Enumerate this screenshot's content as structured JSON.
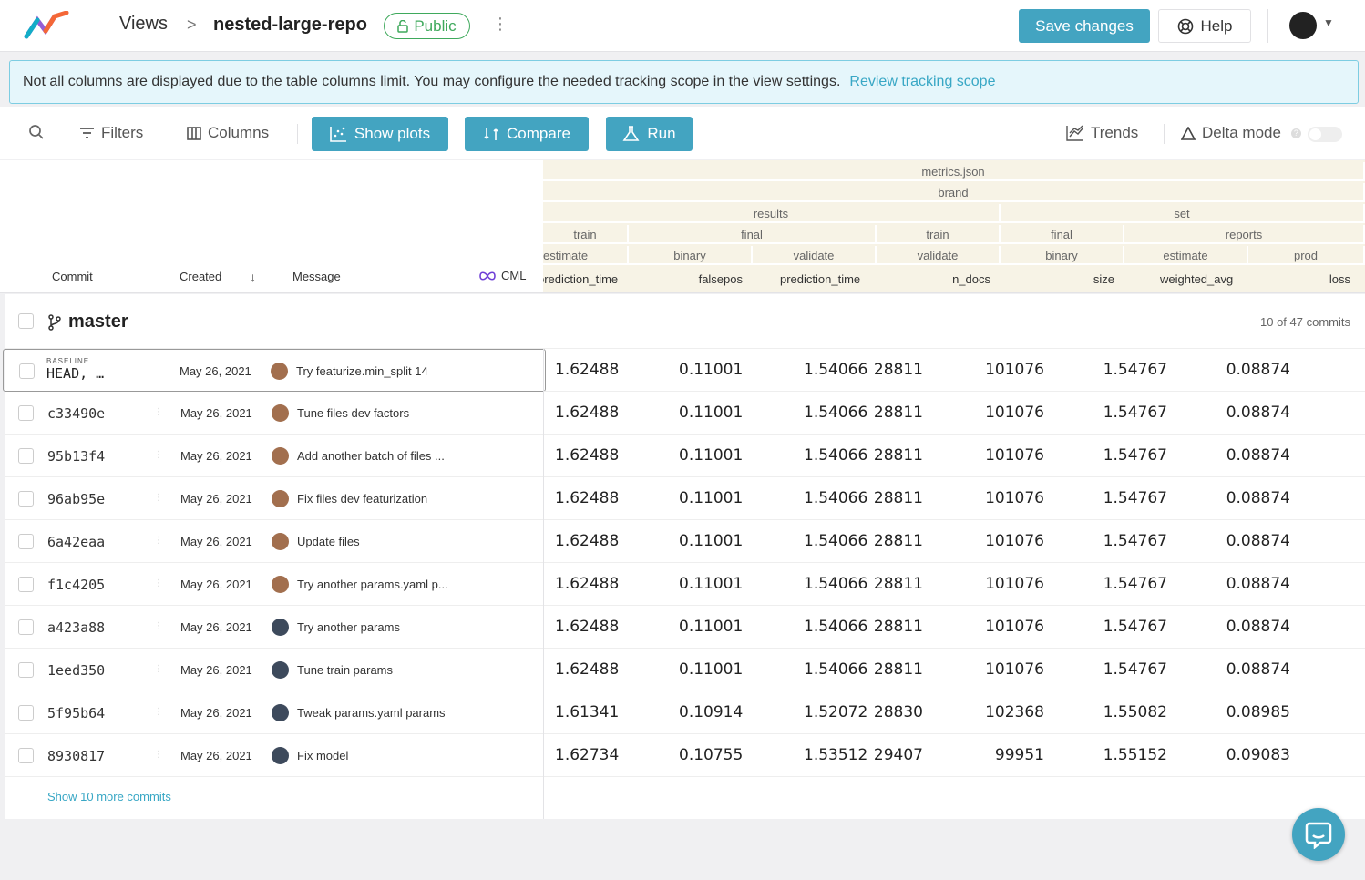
{
  "topbar": {
    "views_label": "Views",
    "separator": ">",
    "repo_name": "nested-large-repo",
    "visibility_badge": "Public",
    "save_label": "Save changes",
    "help_label": "Help"
  },
  "banner": {
    "text": "Not all columns are displayed due to the table columns limit. You may configure the needed tracking scope in the view settings.",
    "link_label": "Review tracking scope"
  },
  "toolbar": {
    "filters_label": "Filters",
    "columns_label": "Columns",
    "show_plots_label": "Show plots",
    "compare_label": "Compare",
    "run_label": "Run",
    "trends_label": "Trends",
    "delta_mode_label": "Delta mode",
    "help_mark": "?"
  },
  "table": {
    "left_headers": {
      "commit": "Commit",
      "created": "Created",
      "message": "Message",
      "cml": "CML"
    },
    "metric_groups": {
      "file": "metrics.json",
      "level2": "brand",
      "level3a": "results",
      "level3b": "set",
      "level4": [
        "train",
        "final",
        "train",
        "final",
        "reports"
      ],
      "level5": [
        "estimate",
        "binary",
        "validate",
        "validate",
        "binary",
        "estimate",
        "prod"
      ]
    },
    "metric_columns": [
      "prediction_time",
      "falsepos",
      "prediction_time",
      "n_docs",
      "size",
      "weighted_avg",
      "loss"
    ],
    "branch": "master",
    "commit_count": "10 of 47 commits",
    "baseline_tag": "BASELINE",
    "baseline_head": "HEAD, …",
    "rows": [
      {
        "commit": "",
        "date": "May 26, 2021",
        "message": "Try featurize.min_split 14",
        "values": [
          "1.62488",
          "0.11001",
          "1.54066",
          "28811",
          "101076",
          "1.54767",
          "0.08874"
        ]
      },
      {
        "commit": "c33490e",
        "date": "May 26, 2021",
        "message": "Tune files dev factors",
        "values": [
          "1.62488",
          "0.11001",
          "1.54066",
          "28811",
          "101076",
          "1.54767",
          "0.08874"
        ]
      },
      {
        "commit": "95b13f4",
        "date": "May 26, 2021",
        "message": "Add another batch of files ...",
        "values": [
          "1.62488",
          "0.11001",
          "1.54066",
          "28811",
          "101076",
          "1.54767",
          "0.08874"
        ]
      },
      {
        "commit": "96ab95e",
        "date": "May 26, 2021",
        "message": "Fix files dev featurization",
        "values": [
          "1.62488",
          "0.11001",
          "1.54066",
          "28811",
          "101076",
          "1.54767",
          "0.08874"
        ]
      },
      {
        "commit": "6a42eaa",
        "date": "May 26, 2021",
        "message": "Update files",
        "values": [
          "1.62488",
          "0.11001",
          "1.54066",
          "28811",
          "101076",
          "1.54767",
          "0.08874"
        ]
      },
      {
        "commit": "f1c4205",
        "date": "May 26, 2021",
        "message": "Try another params.yaml p...",
        "values": [
          "1.62488",
          "0.11001",
          "1.54066",
          "28811",
          "101076",
          "1.54767",
          "0.08874"
        ]
      },
      {
        "commit": "a423a88",
        "date": "May 26, 2021",
        "message": "Try another params",
        "values": [
          "1.62488",
          "0.11001",
          "1.54066",
          "28811",
          "101076",
          "1.54767",
          "0.08874"
        ]
      },
      {
        "commit": "1eed350",
        "date": "May 26, 2021",
        "message": "Tune train params",
        "values": [
          "1.62488",
          "0.11001",
          "1.54066",
          "28811",
          "101076",
          "1.54767",
          "0.08874"
        ]
      },
      {
        "commit": "5f95b64",
        "date": "May 26, 2021",
        "message": "Tweak params.yaml params",
        "values": [
          "1.61341",
          "0.10914",
          "1.52072",
          "28830",
          "102368",
          "1.55082",
          "0.08985"
        ]
      },
      {
        "commit": "8930817",
        "date": "May 26, 2021",
        "message": "Fix model",
        "values": [
          "1.62734",
          "0.10755",
          "1.53512",
          "29407",
          "99951",
          "1.55152",
          "0.09083"
        ]
      }
    ],
    "show_more": "Show 10 more commits"
  },
  "colors": {
    "accent": "#43a4c1",
    "public_green": "#3fa95c",
    "header_bg": "#f7f3e6",
    "banner_bg": "#e5f6fb"
  }
}
